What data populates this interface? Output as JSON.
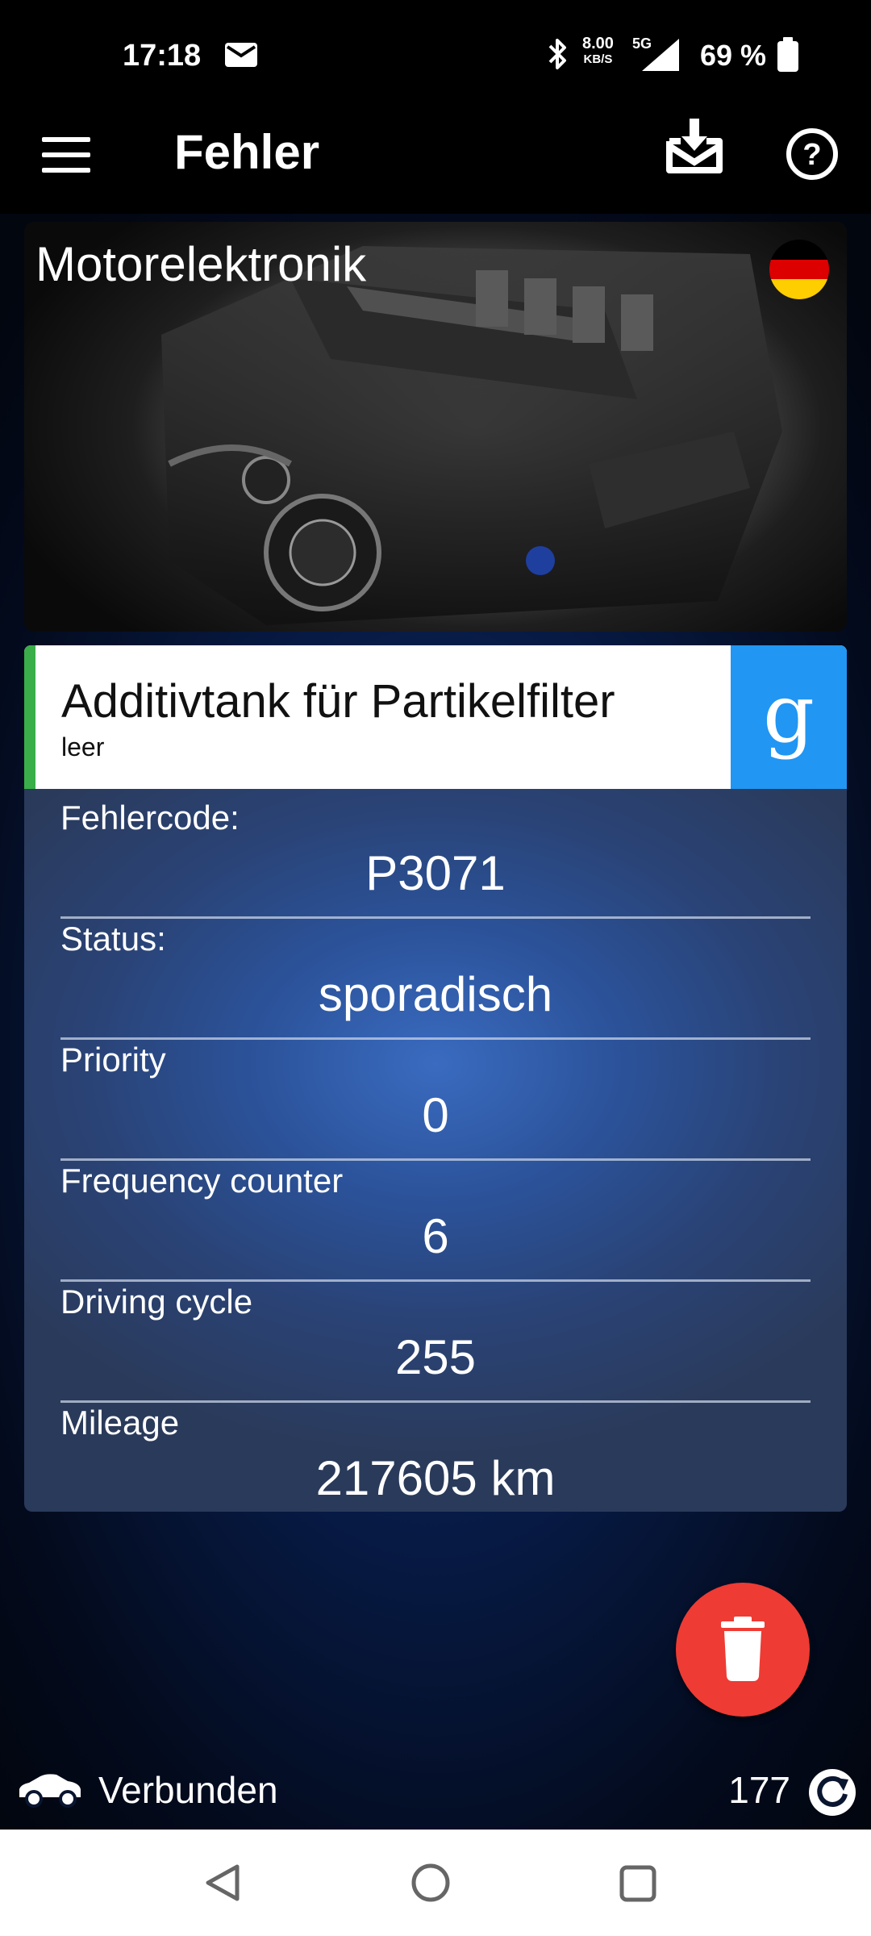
{
  "status_bar": {
    "time": "17:18",
    "speed_value": "8.00",
    "speed_unit": "KB/S",
    "network": "5G",
    "battery": "69 %",
    "icons": [
      "mail-icon",
      "bluetooth-icon",
      "signal-icon",
      "battery-icon"
    ]
  },
  "app_bar": {
    "title": "Fehler",
    "icons": [
      "menu-icon",
      "download-icon",
      "help-icon"
    ]
  },
  "module": {
    "title": "Motorelektronik",
    "flag": "germany-flag-icon"
  },
  "fault": {
    "title": "Additivtank für Partikelfilter",
    "subtitle": "leer",
    "search_button_glyph": "g",
    "accent_color": "#3aae49",
    "search_button_color": "#2196f3"
  },
  "details": [
    {
      "label": "Fehlercode:",
      "value": "P3071"
    },
    {
      "label": "Status:",
      "value": "sporadisch"
    },
    {
      "label": "Priority",
      "value": "0"
    },
    {
      "label": "Frequency counter",
      "value": "6"
    },
    {
      "label": "Driving cycle",
      "value": "255"
    },
    {
      "label": "Mileage",
      "value": "217605 km"
    }
  ],
  "fab": {
    "icon": "trash-icon",
    "color": "#ee3b34"
  },
  "bottom_status": {
    "connection": "Verbunden",
    "count": "177",
    "icons": [
      "car-icon",
      "refresh-icon"
    ]
  },
  "navigation": [
    "back",
    "home",
    "recent"
  ]
}
